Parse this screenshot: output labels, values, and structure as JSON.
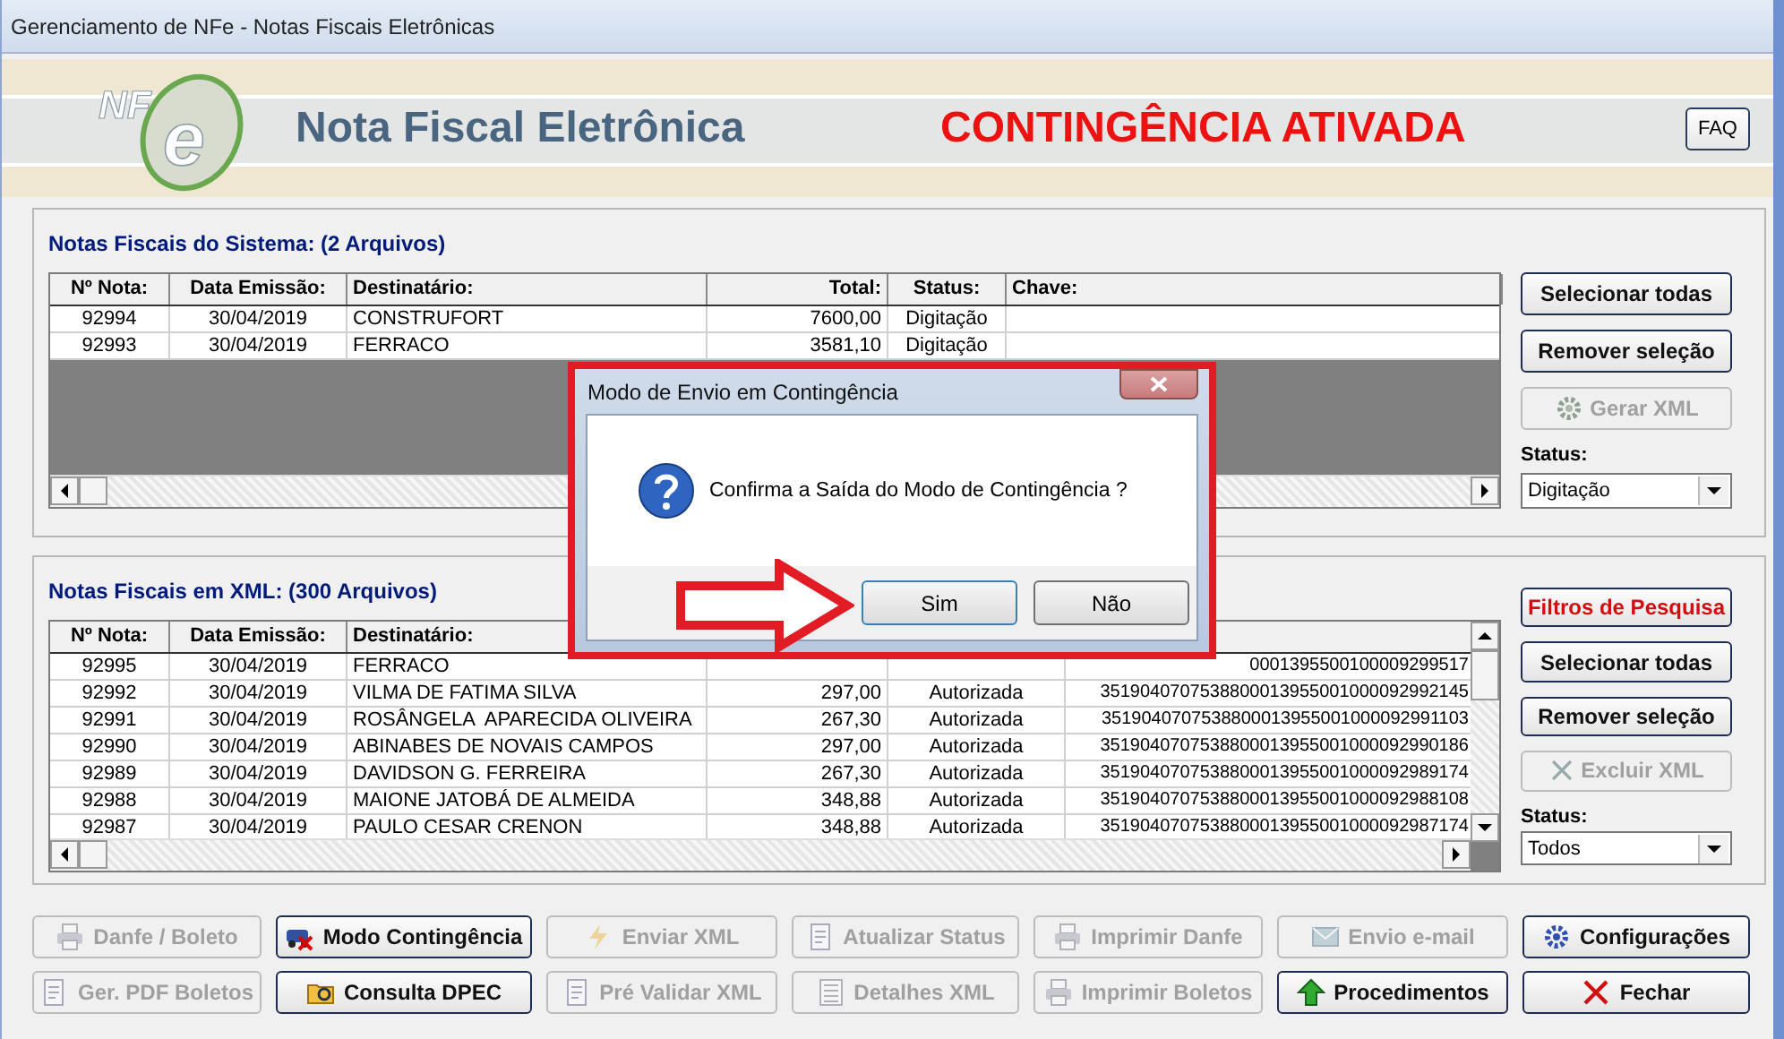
{
  "window": {
    "title": "Gerenciamento de NFe - Notas Fiscais Eletrônicas"
  },
  "header": {
    "logo": [
      "NF",
      "e"
    ],
    "title": "Nota Fiscal Eletrônica",
    "alert": "CONTINGÊNCIA ATIVADA",
    "faq_button": "FAQ"
  },
  "panels": [
    {
      "title": "Notas Fiscais do Sistema: (2 Arquivos)",
      "columns": [
        "Nº Nota:",
        "Data Emissão:",
        "Destinatário:",
        "Total:",
        "Status:",
        "Chave:"
      ],
      "rows": [
        [
          "92994",
          "30/04/2019",
          "CONSTRUFORT",
          "7600,00",
          "Digitação"
        ],
        [
          "92993",
          "30/04/2019",
          "FERRACO",
          "3581,10",
          "Digitação"
        ]
      ],
      "buttons": [
        {
          "label": "Selecionar todas",
          "kind": "plain",
          "disabled": false
        },
        {
          "label": "Remover seleção",
          "kind": "plain",
          "disabled": false
        },
        {
          "label": "Gerar XML",
          "kind": "plain",
          "disabled": true
        }
      ],
      "status_label": "Status:",
      "status_value": "Digitação"
    },
    {
      "title": "Notas Fiscais em XML: (300 Arquivos)",
      "columns": [
        "Nº Nota:",
        "Data Emissão:",
        "Destinatário:"
      ],
      "rows": [
        [
          "92995",
          "30/04/2019",
          "FERRACO",
          null,
          null,
          "0001395500100009299517"
        ],
        [
          "92992",
          "30/04/2019",
          "VILMA DE FATIMA SILVA",
          "297,00",
          "Autorizada",
          "3519040707538800013955001000092992145"
        ],
        [
          "92991",
          "30/04/2019",
          "ROSÂNGELA  APARECIDA OLIVEIRA",
          "267,30",
          "Autorizada",
          "3519040707538800013955001000092991103"
        ],
        [
          "92990",
          "30/04/2019",
          "ABINABES DE NOVAIS CAMPOS",
          "297,00",
          "Autorizada",
          "3519040707538800013955001000092990186"
        ],
        [
          "92989",
          "30/04/2019",
          "DAVIDSON G. FERREIRA",
          "267,30",
          "Autorizada",
          "3519040707538800013955001000092989174"
        ],
        [
          "92988",
          "30/04/2019",
          "MAIONE JATOBÁ DE ALMEIDA",
          "348,88",
          "Autorizada",
          "3519040707538800013955001000092988108"
        ],
        [
          "92987",
          "30/04/2019",
          "PAULO CESAR CRENON",
          "348,88",
          "Autorizada",
          "3519040707538800013955001000092987174"
        ]
      ],
      "buttons": [
        {
          "label": "Filtros de Pesquisa",
          "kind": "filter",
          "disabled": false
        },
        {
          "label": "Selecionar todas",
          "kind": "plain",
          "disabled": false
        },
        {
          "label": "Remover seleção",
          "kind": "plain",
          "disabled": false
        },
        {
          "label": "Excluir XML",
          "kind": "plain",
          "disabled": true
        }
      ],
      "status_label": "Status:",
      "status_value": "Todos"
    }
  ],
  "toolbar": [
    {
      "label": "Danfe / Boleto",
      "disabled": true
    },
    {
      "label": "Modo Contingência",
      "disabled": false
    },
    {
      "label": "Enviar XML",
      "disabled": true
    },
    {
      "label": "Atualizar Status",
      "disabled": true
    },
    {
      "label": "Imprimir Danfe",
      "disabled": true
    },
    {
      "label": "Envio e-mail",
      "disabled": true
    },
    {
      "label": "Configurações",
      "disabled": false
    },
    {
      "label": "Ger. PDF Boletos",
      "disabled": true
    },
    {
      "label": "Consulta DPEC",
      "disabled": false
    },
    {
      "label": "Pré Validar XML",
      "disabled": true
    },
    {
      "label": "Detalhes XML",
      "disabled": true
    },
    {
      "label": "Imprimir Boletos",
      "disabled": true
    },
    {
      "label": "Procedimentos",
      "disabled": false
    },
    {
      "label": "Fechar",
      "disabled": false
    }
  ],
  "dialog": {
    "title": "Modo de Envio em Contingência",
    "message": "Confirma a Saída do Modo de Contingência ?",
    "buttons": [
      "Sim",
      "Não"
    ]
  }
}
